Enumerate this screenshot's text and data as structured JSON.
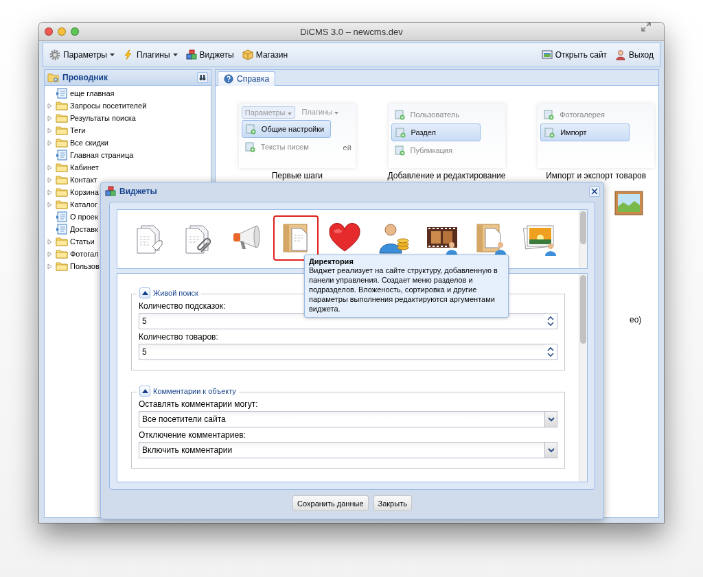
{
  "window": {
    "title": "DiCMS 3.0 – newcms.dev"
  },
  "toolbar": {
    "left": [
      {
        "label": "Параметры",
        "dropdown": true
      },
      {
        "label": "Плагины",
        "dropdown": true
      },
      {
        "label": "Виджеты",
        "dropdown": false
      },
      {
        "label": "Магазин",
        "dropdown": false
      }
    ],
    "right": [
      {
        "label": "Открыть сайт"
      },
      {
        "label": "Выход"
      }
    ]
  },
  "explorer": {
    "title": "Проводник",
    "items": [
      {
        "label": "еще главная",
        "kind": "page"
      },
      {
        "label": "Запросы посетителей",
        "kind": "folder"
      },
      {
        "label": "Результаты поиска",
        "kind": "folder"
      },
      {
        "label": "Теги",
        "kind": "folder"
      },
      {
        "label": "Все скидки",
        "kind": "folder"
      },
      {
        "label": "Главная страница",
        "kind": "page"
      },
      {
        "label": "Кабинет",
        "kind": "folder"
      },
      {
        "label": "Контакт",
        "kind": "folder"
      },
      {
        "label": "Корзина",
        "kind": "folder"
      },
      {
        "label": "Каталог",
        "kind": "folder"
      },
      {
        "label": "О проек",
        "kind": "page"
      },
      {
        "label": "Доставк",
        "kind": "page"
      },
      {
        "label": "Статьи",
        "kind": "folder"
      },
      {
        "label": "Фотогал",
        "kind": "folder"
      },
      {
        "label": "Пользов",
        "kind": "folder"
      }
    ]
  },
  "tabs": [
    {
      "label": "Справка",
      "selected": true
    }
  ],
  "help": {
    "panels": [
      {
        "buttons": [
          "Параметры",
          "Плагины"
        ],
        "fragment": "ей",
        "items": [
          {
            "label": "Общие настройки",
            "selected": true
          },
          {
            "label": "Тексты писем",
            "selected": false
          }
        ],
        "caption": "Первые шаги"
      },
      {
        "items": [
          {
            "label": "Пользователь",
            "selected": false
          },
          {
            "label": "Раздел",
            "selected": true
          },
          {
            "label": "Публикация",
            "selected": false
          }
        ],
        "caption": "Добавление и редактирование"
      },
      {
        "items": [
          {
            "label": "Фотогалерея",
            "selected": false
          },
          {
            "label": "Импорт",
            "selected": true
          }
        ],
        "caption": "Импорт и экспорт товаров"
      }
    ],
    "fragment": "ео)"
  },
  "dialog": {
    "title": "Виджеты",
    "widgets": [
      {
        "selected": false
      },
      {
        "selected": false
      },
      {
        "selected": false
      },
      {
        "selected": true
      },
      {
        "selected": false
      },
      {
        "selected": false
      },
      {
        "selected": false
      },
      {
        "selected": false
      },
      {
        "selected": false
      }
    ],
    "tooltip": {
      "title": "Директория",
      "text": "Виджет реализует на сайте структуру, добавленную в панели управления. Создает меню разделов и подразделов. Вложеность, сортировка и другие параметры выполнения редактируются аргументами виджета."
    },
    "sections": [
      {
        "title": "Живой поиск",
        "expanded": true,
        "fields": [
          {
            "label": "Количество подсказок:",
            "value": "5",
            "kind": "spinner"
          },
          {
            "label": "Количество товаров:",
            "value": "5",
            "kind": "spinner"
          }
        ]
      },
      {
        "title": "Комментарии к объекту",
        "expanded": true,
        "fields": [
          {
            "label": "Оставлять комментарии могут:",
            "value": "Все посетители сайта",
            "kind": "select"
          },
          {
            "label": "Отключение комментариев:",
            "value": "Включить комментарии",
            "kind": "select"
          }
        ]
      }
    ],
    "buttons": [
      "Сохранить данные",
      "Закрыть"
    ]
  }
}
